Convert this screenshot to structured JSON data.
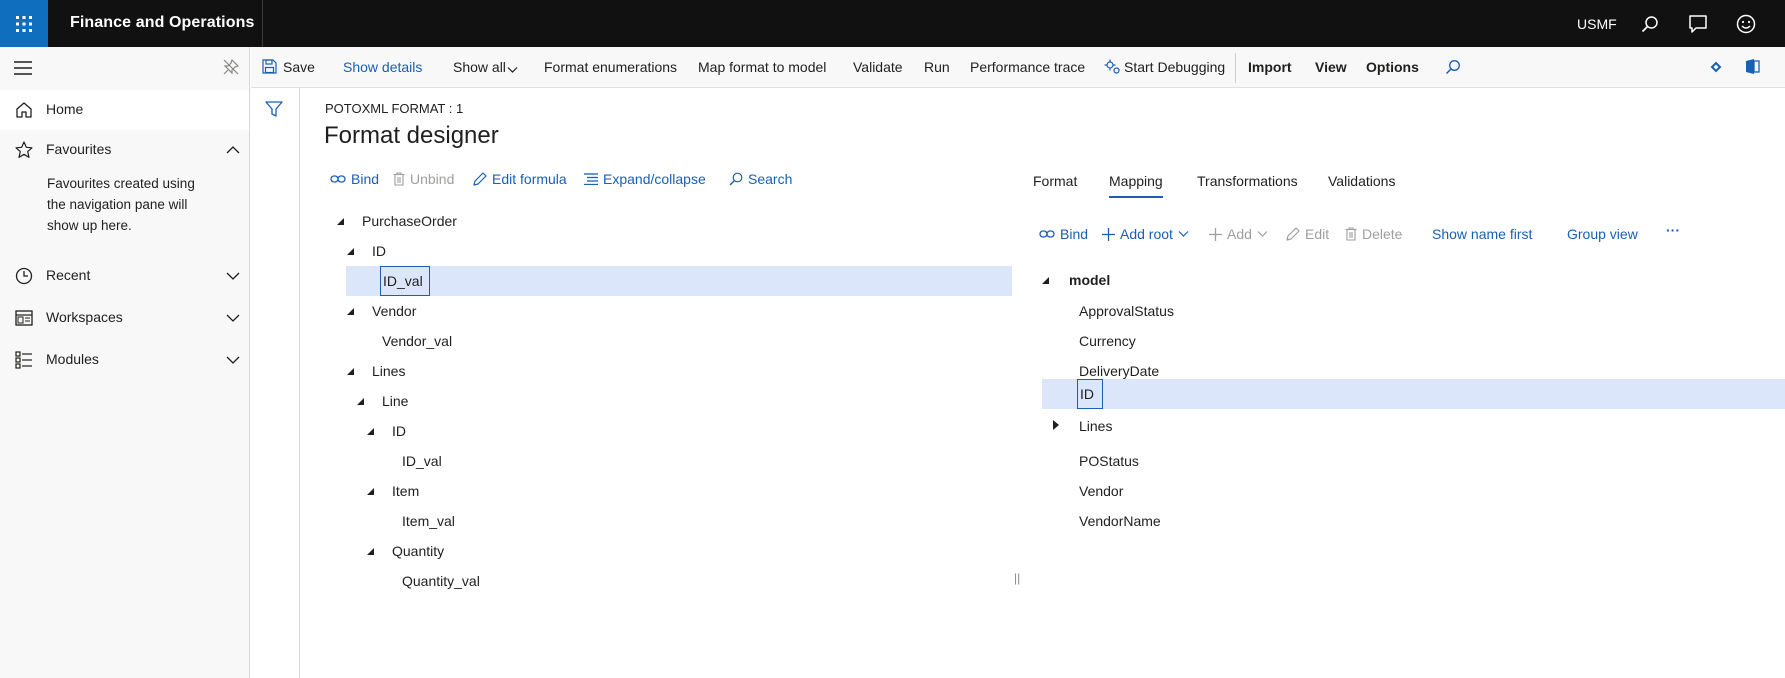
{
  "app": {
    "title": "Finance and Operations",
    "company": "USMF",
    "icons": [
      "waffle-icon",
      "search-icon",
      "feedback-icon",
      "smiley-icon"
    ]
  },
  "nav": {
    "items": [
      {
        "label": "Home",
        "icon": "home-icon"
      },
      {
        "label": "Favourites",
        "icon": "star-icon"
      },
      {
        "label": "Recent",
        "icon": "clock-icon"
      },
      {
        "label": "Workspaces",
        "icon": "workspace-icon"
      },
      {
        "label": "Modules",
        "icon": "modules-icon"
      }
    ],
    "favourites_empty": "Favourites created using the navigation pane will show up here."
  },
  "actions": {
    "save": "Save",
    "show_details": "Show details",
    "show_all": "Show all",
    "format_enumerations": "Format enumerations",
    "map_format_to_model": "Map format to model",
    "validate": "Validate",
    "run": "Run",
    "performance_trace": "Performance trace",
    "start_debugging": "Start Debugging",
    "import": "Import",
    "view": "View",
    "options": "Options"
  },
  "page": {
    "breadcrumb": "POTOXML FORMAT : 1",
    "title": "Format designer"
  },
  "format_toolbar": {
    "bind": "Bind",
    "unbind": "Unbind",
    "edit_formula": "Edit formula",
    "expand_collapse": "Expand/collapse",
    "search": "Search"
  },
  "format_tree": [
    {
      "label": "PurchaseOrder",
      "expanded": true
    },
    {
      "label": "ID",
      "expanded": true
    },
    {
      "label": "ID_val",
      "selected": true
    },
    {
      "label": "Vendor",
      "expanded": true
    },
    {
      "label": "Vendor_val"
    },
    {
      "label": "Lines",
      "expanded": true
    },
    {
      "label": "Line",
      "expanded": true
    },
    {
      "label": "ID",
      "expanded": true
    },
    {
      "label": "ID_val"
    },
    {
      "label": "Item",
      "expanded": true
    },
    {
      "label": "Item_val"
    },
    {
      "label": "Quantity",
      "expanded": true
    },
    {
      "label": "Quantity_val"
    }
  ],
  "tabs": [
    "Format",
    "Mapping",
    "Transformations",
    "Validations"
  ],
  "active_tab": "Mapping",
  "mapping_toolbar": {
    "bind": "Bind",
    "add_root": "Add root",
    "add": "Add",
    "edit": "Edit",
    "delete": "Delete",
    "show_name_first": "Show name first",
    "group_view": "Group view",
    "more": "···"
  },
  "model_tree": [
    {
      "label": "model",
      "expanded": true
    },
    {
      "label": "ApprovalStatus"
    },
    {
      "label": "Currency"
    },
    {
      "label": "DeliveryDate"
    },
    {
      "label": "ID",
      "selected": true
    },
    {
      "label": "Lines",
      "collapsed": true
    },
    {
      "label": "POStatus"
    },
    {
      "label": "Vendor"
    },
    {
      "label": "VendorName"
    }
  ],
  "splitter": "||",
  "colors": {
    "topbar": "#111111",
    "waffle": "#106ebe",
    "accent": "#1a5fb4",
    "selection": "#dbe6fb"
  }
}
